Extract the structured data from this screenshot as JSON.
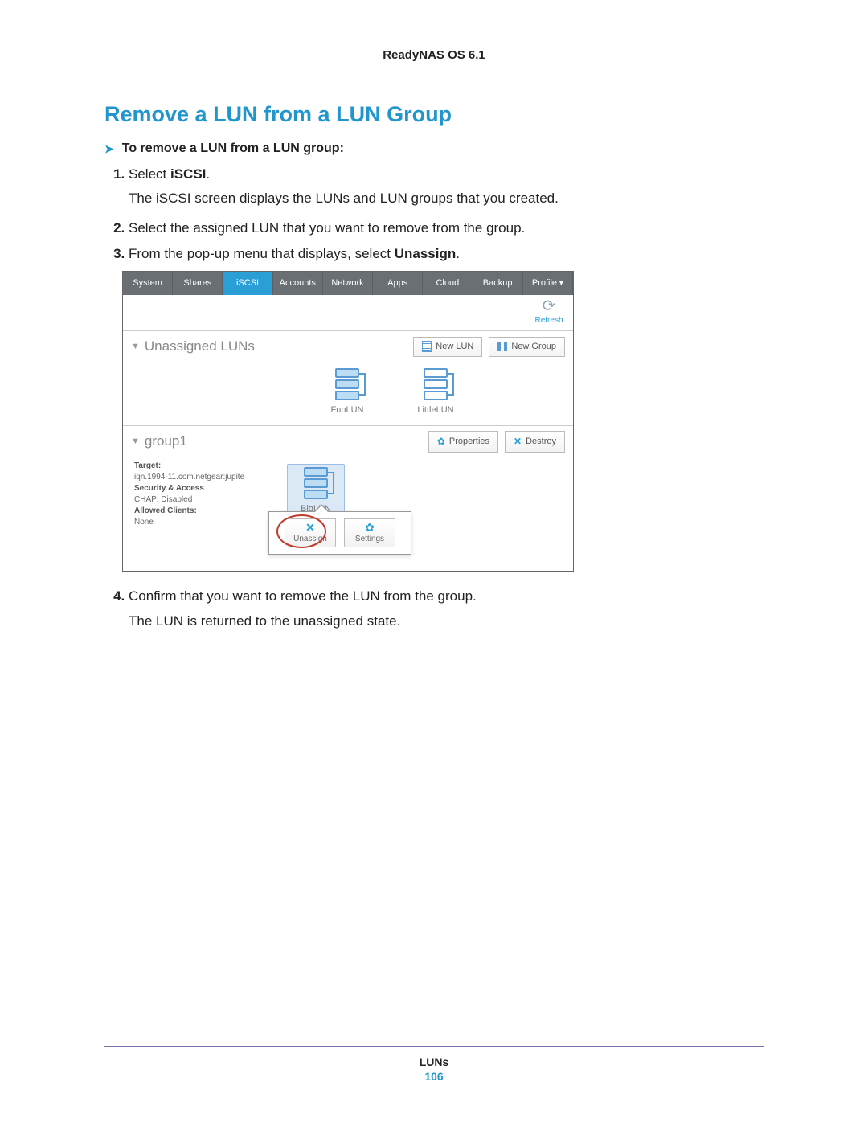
{
  "header": {
    "product": "ReadyNAS OS 6.1"
  },
  "section": {
    "title": "Remove a LUN from a LUN Group",
    "subheading": "To remove a LUN from a LUN group:"
  },
  "steps": {
    "s1a": "Select ",
    "s1b": "iSCSI",
    "s1c": ".",
    "s1_body": "The iSCSI screen displays the LUNs and LUN groups that you created.",
    "s2": "Select the assigned LUN that you want to remove from the group.",
    "s3a": "From the pop-up menu that displays, select ",
    "s3b": "Unassign",
    "s3c": ".",
    "s4": "Confirm that you want to remove the LUN from the group.",
    "s4_body": "The LUN is returned to the unassigned state."
  },
  "app": {
    "tabs": [
      "System",
      "Shares",
      "iSCSI",
      "Accounts",
      "Network",
      "Apps",
      "Cloud",
      "Backup",
      "Profile"
    ],
    "refresh": "Refresh",
    "panel_unassigned": {
      "title": "Unassigned LUNs",
      "btn_newlun": "New LUN",
      "btn_newgroup": "New Group",
      "luns": [
        "FunLUN",
        "LittleLUN"
      ]
    },
    "panel_group": {
      "title": "group1",
      "btn_props": "Properties",
      "btn_destroy": "Destroy",
      "target_label": "Target:",
      "target_value": "iqn.1994-11.com.netgear:jupite",
      "sec_label": "Security & Access",
      "sec_value": "CHAP: Disabled",
      "clients_label": "Allowed Clients:",
      "clients_value": "None",
      "lun": "BigLUN",
      "popup_unassign": "Unassign",
      "popup_settings": "Settings"
    }
  },
  "footer": {
    "category": "LUNs",
    "page": "106"
  }
}
